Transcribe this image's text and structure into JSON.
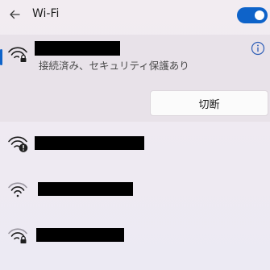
{
  "header": {
    "back_icon": "arrow-left-icon",
    "title": "Wi-Fi",
    "wifi_toggle": {
      "state": "on",
      "color": "#0e63c9"
    }
  },
  "connected_network": {
    "icon": "wifi-secured-icon",
    "ssid_redacted": true,
    "status": "接続済み、セキュリティ保護あり",
    "info_icon": "info-icon",
    "disconnect_label": "切断",
    "accent_color": "#0e63c9"
  },
  "networks": [
    {
      "icon": "wifi-warning-icon",
      "ssid_redacted": true
    },
    {
      "icon": "wifi-open-icon",
      "ssid_redacted": true
    },
    {
      "icon": "wifi-secured-icon",
      "ssid_redacted": true
    }
  ]
}
